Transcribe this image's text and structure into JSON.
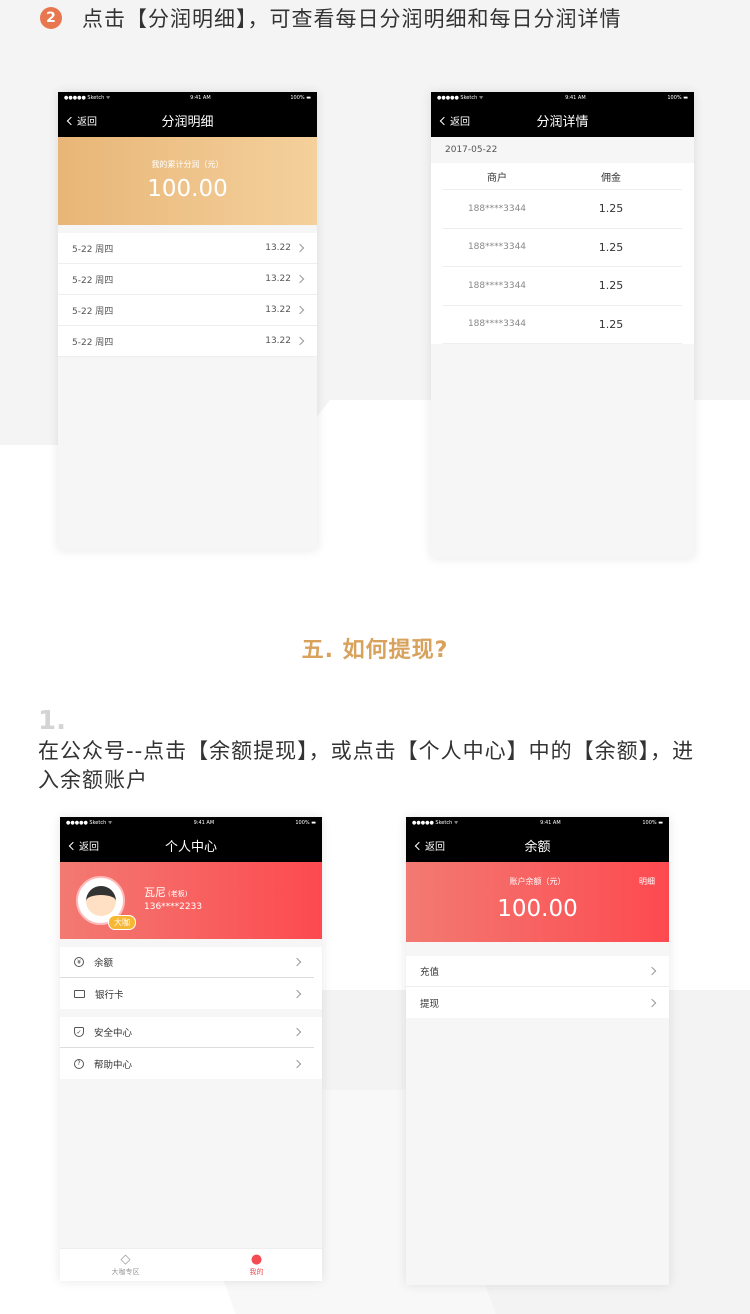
{
  "step2": {
    "num": "2",
    "text": "点击【分润明细】，可查看每日分润明细和每日分润详情"
  },
  "status": {
    "carrier": "●●●●● Sketch ᯤ",
    "time": "9:41 AM",
    "battery": "100% ▬"
  },
  "back_label": "返回",
  "phone1": {
    "title": "分润明细",
    "banner_label": "我的累计分润（元）",
    "banner_amount": "100.00",
    "rows": [
      {
        "date": "5-22  周四",
        "amount": "13.22"
      },
      {
        "date": "5-22  周四",
        "amount": "13.22"
      },
      {
        "date": "5-22  周四",
        "amount": "13.22"
      },
      {
        "date": "5-22  周四",
        "amount": "13.22"
      }
    ]
  },
  "phone2": {
    "title": "分润详情",
    "date": "2017-05-22",
    "headers": [
      "商户",
      "佣金"
    ],
    "rows": [
      {
        "merchant": "188****3344",
        "commission": "1.25"
      },
      {
        "merchant": "188****3344",
        "commission": "1.25"
      },
      {
        "merchant": "188****3344",
        "commission": "1.25"
      },
      {
        "merchant": "188****3344",
        "commission": "1.25"
      }
    ]
  },
  "section_title": "五. 如何提现?",
  "step1": {
    "num": "1.",
    "text": "在公众号--点击【余额提现】，或点击【个人中心】中的【余额】，进入余额账户"
  },
  "phone3": {
    "title": "个人中心",
    "user_name": "瓦尼",
    "user_role": "(老板)",
    "user_phone": "136****2233",
    "badge": "大咖",
    "menu_group1": [
      {
        "label": "余额",
        "icon": "¥"
      },
      {
        "label": "银行卡",
        "icon": ""
      }
    ],
    "menu_group2": [
      {
        "label": "安全中心",
        "icon": "✓"
      },
      {
        "label": "帮助中心",
        "icon": "?"
      }
    ],
    "tabs": [
      {
        "label": "大咖专区",
        "icon": "◇"
      },
      {
        "label": "我的",
        "icon": "●"
      }
    ]
  },
  "phone4": {
    "title": "余额",
    "banner_label": "账户余额（元）",
    "banner_amount": "100.00",
    "detail_label": "明细",
    "rows": [
      {
        "label": "充值"
      },
      {
        "label": "提现"
      }
    ]
  }
}
